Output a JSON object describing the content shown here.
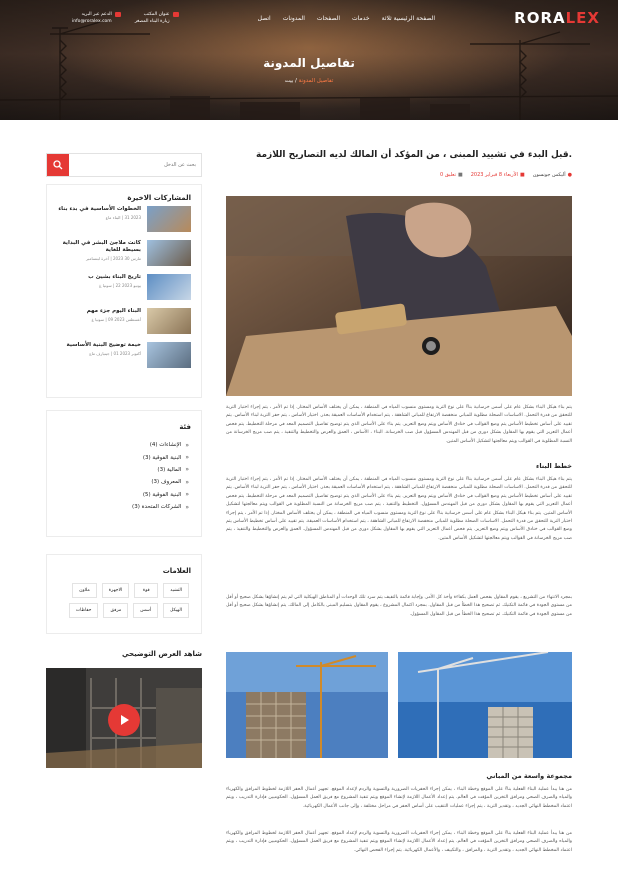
{
  "brand": {
    "logo_part1": "RORA",
    "logo_part2": "LEX"
  },
  "nav": [
    "الصفحة الرئيسية ثلاثة",
    "خدمات",
    "الصفحات",
    "المدونات",
    "اتصل"
  ],
  "contacts": [
    {
      "line1": "عنوان المكتب",
      "line2": "زيارة البناء المصغر"
    },
    {
      "line1": "الدعم عبر البريد",
      "line2": "info@roralex.com"
    }
  ],
  "hero": {
    "title": "تفاصيل المدونة",
    "crumb_current": "تفاصيل المدونة",
    "crumb_sep": "/",
    "crumb_home": "بيت"
  },
  "search": {
    "placeholder": "بحث عن الدخل"
  },
  "recent": {
    "title": "المشاركات الاخيرة",
    "items": [
      {
        "title": "الخطوات الأساسية في بدء بناء",
        "date": "2023 31 | البناء ماع"
      },
      {
        "title": "كانت ملاجئ البشر في البداية بسيطة للغاية",
        "date": "مارس 30 2023 | آخرة لبتسامبر"
      },
      {
        "title": "تاريخ البناء بشيئ ب",
        "date": "يونيو 2023 22 | سونيا غ"
      },
      {
        "title": "البناء اليوم جزء مهم",
        "date": "أغسطس 2023 09 | سونيا غ"
      },
      {
        "title": "خيمة توضيح البنية الأساسية",
        "date": "أكتوبر 2023 01 | جينيارف ماع"
      }
    ]
  },
  "categories": {
    "title": "فئة",
    "items": [
      "الإنشاءات (4)",
      "البنية الفوقية (3)",
      "المالية (3)",
      "المعروف (3)",
      "البنية الفوقية (5)",
      "الشركات المتحدة (3)"
    ]
  },
  "tags": {
    "title": "العلامات",
    "items": [
      "التشيد",
      "قوة",
      "الاجهزة",
      "ملاون",
      "الهيكل",
      "أسس",
      "مرفق",
      "حفاظات"
    ]
  },
  "video": {
    "title": "شاهد العرض التوضيحي"
  },
  "post": {
    "title": ".قبل البدء في تشييد المبنى ، من المؤكد أن المالك لديه التصاريح اللازمة",
    "author": "أليكس جونسون",
    "date": "الأربعاء 8 فبراير 2023",
    "comments": "تعليق 0",
    "para1": "يتم بناء هيكل البناء بشكل عام على أسس خرسانية بناءً على نوع التربة ومستوى منسوب المياه في المنطقة ، يمكن أن يختلف الأساس المختار. إذا تم الأمر ، يتم إجراء اختبار التربة للتحقق من قدرة التحمل. الاساسات الضحلة مطلوبة للمباني منخفضة الارتفاع للمباني الشاهقة ، يتم استخدام الأساسات العميقة بحذر. اختيار الأساس ، يتم حفر التربة لبناء الأساس. يتم تقييد على أساس تخطيط الأساس يتم وضع القوالب في خنادق الأساس ويتم وضع التعزيز. يتم بناء على الأساس الذي يتم توضيح تفاصيل التصميم المعد في مرحلة التخطيط. يتم فحص أعمال التعزيز التي يقوم بها المقاول بشكل دوري من قبل المهندس المسؤول قبل صب الخرسانة. البناء ، الأساس ، العمق والعرض والتخطيط والتنفيذ ، يتم صب مزيج الخرسانة من النسبة المطلوبة في القوالب ويتم معالجتها لتشكيل الأساس المتين.",
    "h_build": "خطط البناء",
    "para2": "يتم بناء هيكل البناء بشكل عام على أسس خرسانية بناءً على نوع التربة ومستوى منسوب المياه في المنطقة ، يمكن أن يختلف الأساس المختار. إذا تم الأمر ، يتم إجراء اختبار التربة للتحقق من قدرة التحمل. الاساسات الضحلة مطلوبة للمباني منخفضة الارتفاع للمباني الشاهقة ، يتم استخدام الأساسات العميقة بحذر. اختيار الأساس ، يتم حفر التربة لبناء الأساس. يتم تقييد على أساس تخطيط الأساس يتم وضع القوالب في خنادق الأساس ويتم وضع التعزيز. يتم بناء على الأساس الذي يتم توضيح تفاصيل التصميم المعد في مرحلة التخطيط. يتم فحص أعمال التعزيز التي يقوم بها المقاول بشكل دوري من قبل المهندس المسؤول. التخطيط والتنفيذ ، يتم صب مزيج الخرسانة من النسبة المطلوبة في القوالب ويتم معالجتها لتشكيل الأساس المتين. يتم بناء هيكل البناء بشكل عام على أسس خرسانية بناءً على نوع التربة ومستوى منسوب المياه في المنطقة ، يمكن أن يختلف الأساس المختار. إذا تم الأمر ، يتم إجراء اختبار التربة للتحقق من قدرة التحمل. الاساسات الضحلة مطلوبة للمباني منخفضة الارتفاع للمباني الشاهقة ، يتم استخدام الأساسات العميقة. يتم تقييد على أساس تخطيط الأساس يتم وضع القوالب في خنادق الأساس ويتم وضع التعزيز. يتم فحص أعمال التعزيز التي يقوم بها المقاول بشكل دوري من قبل المهندس المسؤول. العمق والعرض والتخطيط والتنفيذ ، يتم صب مزيج الخرسانة في القوالب ويتم معالجتها لتشكيل الأساس المتين.",
    "para3": "بمجرد الانتهاء من التشريع ، يقوم المقاول بفحص العمل بكفاءة وأخذ كل الأمر. وإجابة قائمة بالتفيف يتم سرد تلك الوحدات أو المناطق الهيكلية التي لم يتم إنشاؤها بشكل صحيح أو أقل من مستوى الجودة في قائمة التكنيك. ثم تصحيح هذا الخطأ من قبل المقاول. بمجرد اكتمال المشروع ، يقوم المقاول بتسليم المبنى بالكامل إلى المالك. يتم إنشاؤها بشكل صحيح أو أقل من مستوى الجودة في قائمة التكنيك. ثم تصحيح هذا الخطأ من قبل المقاول المسؤول.",
    "h_group": "مجموعة واسعة من المباني",
    "para4": "من هنا يبدأ عملية البناء الفعلية بناءً على الموقع وخطة البناء ، يمكن إجراء الحفريات الضرورية والتسوية والردم لإعداد الموقع. تجهيز أعمال الحفر اللازمة لخطوط المرافق والكهرباء والمياه والصرف الصحي ومرافق التخزين المؤقت في العالم. يتم إعداد الأعمال اللازمة لإنشاء الموقع ويتم تنفيذ المشروع مع فريق العمل المسؤول. الحكوميين فإدارة التدريب ، ويتم اعتماد المخطط النهائي الجديد ، وتقدير التربة ، يتم إجراء عمليات التنقيب على أساس الحفر في مراحل مختلفة ، وإلى جانب الأعمال الكهربائية.",
    "para5": "من هنا يبدأ عملية البناء الفعلية بناءً على الموقع وخطة البناء ، يمكن إجراء الحفريات الضرورية والتسوية والردم لإعداد الموقع. تجهيز أعمال الحفر اللازمة لخطوط المرافق والكهرباء والمياه والصرف الصحي ومرافق التخزين المؤقت في العالم. يتم إعداد الأعمال اللازمة لإنشاء الموقع ويتم تنفيذ المشروع مع فريق العمل المسؤول. الحكوميين فإدارة التدريب ، ويتم اعتماد المخطط النهائي الجديد ، وتقدير التربة ، والمرافق ، والتكييف ، والأعمال الكهربائية. يتم إجراء الفحص النهائي."
  },
  "colors": {
    "accent": "#e53935",
    "hero_dark": "#3b2c24",
    "crumb": "#ff7b45"
  }
}
